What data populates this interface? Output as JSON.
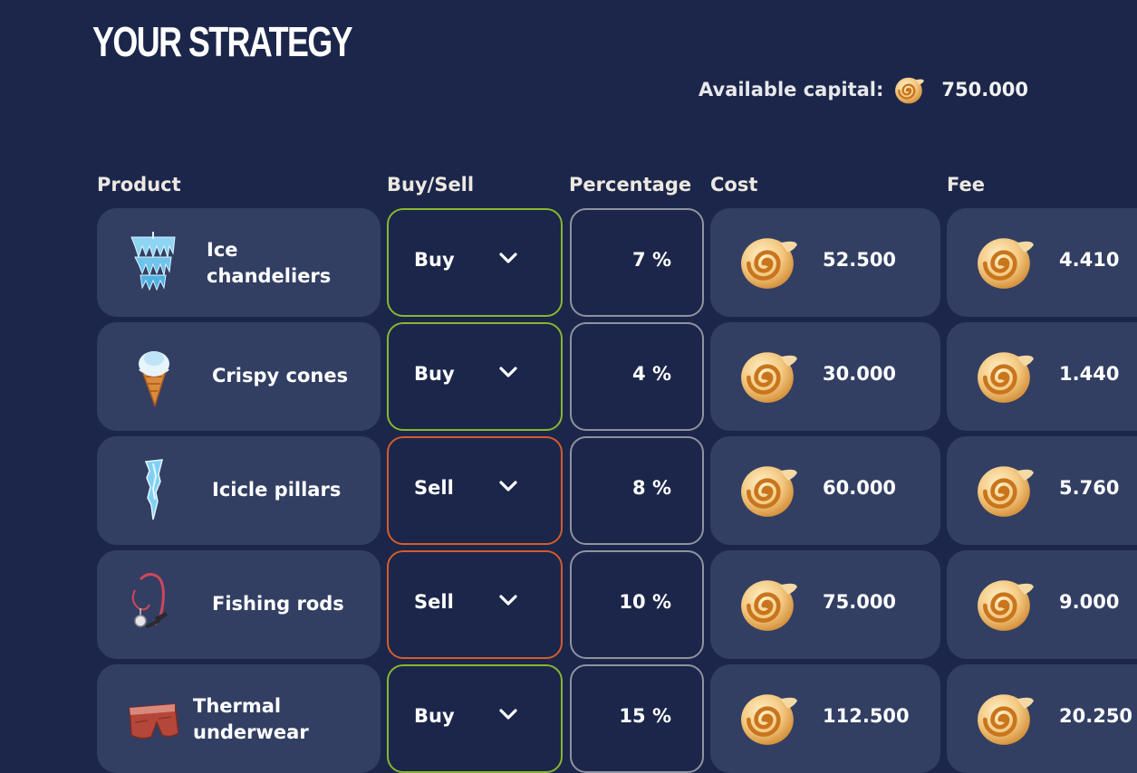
{
  "title": "YOUR STRATEGY",
  "capital": {
    "label": "Available capital:",
    "value": "750.000"
  },
  "columns": {
    "product": "Product",
    "buy_sell": "Buy/Sell",
    "percentage": "Percentage",
    "cost": "Cost",
    "fee": "Fee"
  },
  "colors": {
    "buy_border": "#8bb52f",
    "sell_border": "#d45d2b",
    "percent_border": "#8f939e",
    "card": "#323f63",
    "background": "#1b264a"
  },
  "rows": [
    {
      "icon": "ice-chandelier-icon",
      "name_line1": "Ice",
      "name_line2": "chandeliers",
      "action": "Buy",
      "percentage": "7 %",
      "cost": "52.500",
      "fee": "4.410"
    },
    {
      "icon": "ice-cream-cone-icon",
      "name_line1": "Crispy cones",
      "name_line2": "",
      "action": "Buy",
      "percentage": "4 %",
      "cost": "30.000",
      "fee": "1.440"
    },
    {
      "icon": "icicle-icon",
      "name_line1": "Icicle pillars",
      "name_line2": "",
      "action": "Sell",
      "percentage": "8 %",
      "cost": "60.000",
      "fee": "5.760"
    },
    {
      "icon": "fishing-rod-icon",
      "name_line1": "Fishing rods",
      "name_line2": "",
      "action": "Sell",
      "percentage": "10 %",
      "cost": "75.000",
      "fee": "9.000"
    },
    {
      "icon": "thermal-underwear-icon",
      "name_line1": "Thermal",
      "name_line2": "underwear",
      "action": "Buy",
      "percentage": "15 %",
      "cost": "112.500",
      "fee": "20.250"
    }
  ]
}
